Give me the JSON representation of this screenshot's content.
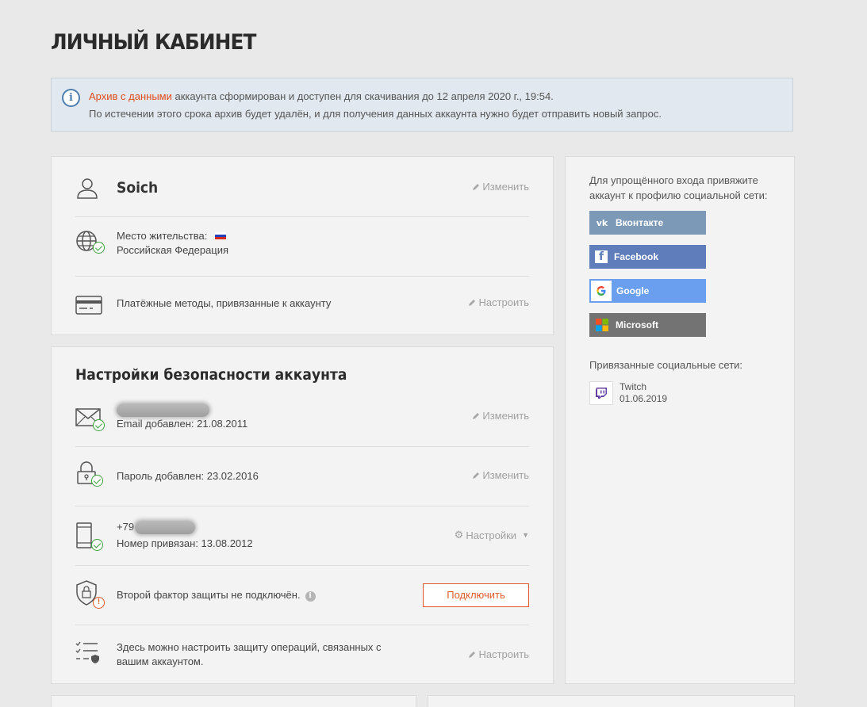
{
  "page": {
    "title": "ЛИЧНЫЙ КАБИНЕТ"
  },
  "notice": {
    "link": "Архив с данными",
    "line1_rest": " аккаунта сформирован и доступен для скачивания до 12 апреля 2020 г., 19:54.",
    "line2": "По истечении этого срока архив будет удалён, и для получения данных аккаунта нужно будет отправить новый запрос."
  },
  "profile": {
    "username": "Soich",
    "edit_label": "Изменить",
    "residence_label": "Место жительства:",
    "residence_value": "Российская Федерация",
    "payment_label": "Платёжные методы, привязанные к аккаунту",
    "payment_action": "Настроить"
  },
  "security": {
    "title": "Настройки безопасности аккаунта",
    "email_added": "Email добавлен: 21.08.2011",
    "email_action": "Изменить",
    "password_added": "Пароль добавлен: 23.02.2016",
    "password_action": "Изменить",
    "phone_prefix": "+79",
    "phone_bound": "Номер привязан: 13.08.2012",
    "phone_action": "Настройки",
    "twofa_text": "Второй фактор защиты не подключён.",
    "twofa_button": "Подключить",
    "ops_line1": "Здесь можно настроить защиту операций, связанных с",
    "ops_line2": "вашим аккаунтом.",
    "ops_action": "Настроить"
  },
  "social": {
    "note": "Для упрощённого входа привяжите аккаунт к профилю социальной сети:",
    "buttons": [
      {
        "label": "Вконтакте",
        "color": "#7c9ab8",
        "icon": "vk-icon"
      },
      {
        "label": "Facebook",
        "color": "#5f7dbb",
        "icon": "facebook-icon"
      },
      {
        "label": "Google",
        "color": "#6a9ff0",
        "icon": "google-icon"
      },
      {
        "label": "Microsoft",
        "color": "#737373",
        "icon": "microsoft-icon"
      }
    ],
    "linked_title": "Привязанные социальные сети:",
    "linked": [
      {
        "name": "Twitch",
        "date": "01.06.2019"
      }
    ]
  }
}
